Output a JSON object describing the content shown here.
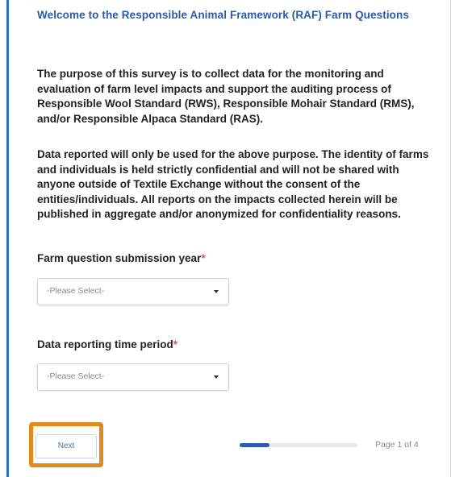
{
  "survey": {
    "title": "Welcome to the Responsible Animal Framework (RAF) Farm Questions",
    "intro_paragraph_1": "The purpose of this survey is to collect data for the monitoring and evaluation of farm level impacts and support the auditing process of Responsible Wool Standard (RWS), Responsible Mohair Standard (RMS), and/or Responsible Alpaca Standard (RAS).",
    "intro_paragraph_2": "Data reported will only be used for the above purpose. The identity of farms and individuals is held strictly confidential and will not be shared with anyone outside of Textile Exchange without the consent of the entities/individuals. All reports on the impacts collected herein will be published in aggregate and/or anonymized for confidentiality reasons."
  },
  "fields": {
    "submission_year": {
      "label": "Farm question submission year",
      "required_mark": "*",
      "selected": "-Please Select-"
    },
    "reporting_period": {
      "label": "Data reporting time period",
      "required_mark": "*",
      "selected": "-Please Select-"
    }
  },
  "footer": {
    "next_label": "Next",
    "page_indicator": "Page 1 of 4",
    "progress_fraction": 0.25
  },
  "colors": {
    "accent": "#2d5aa8",
    "highlight": "#e08a1e",
    "required": "#e05050"
  },
  "icons": {
    "select_caret": "chevron-down-icon"
  }
}
